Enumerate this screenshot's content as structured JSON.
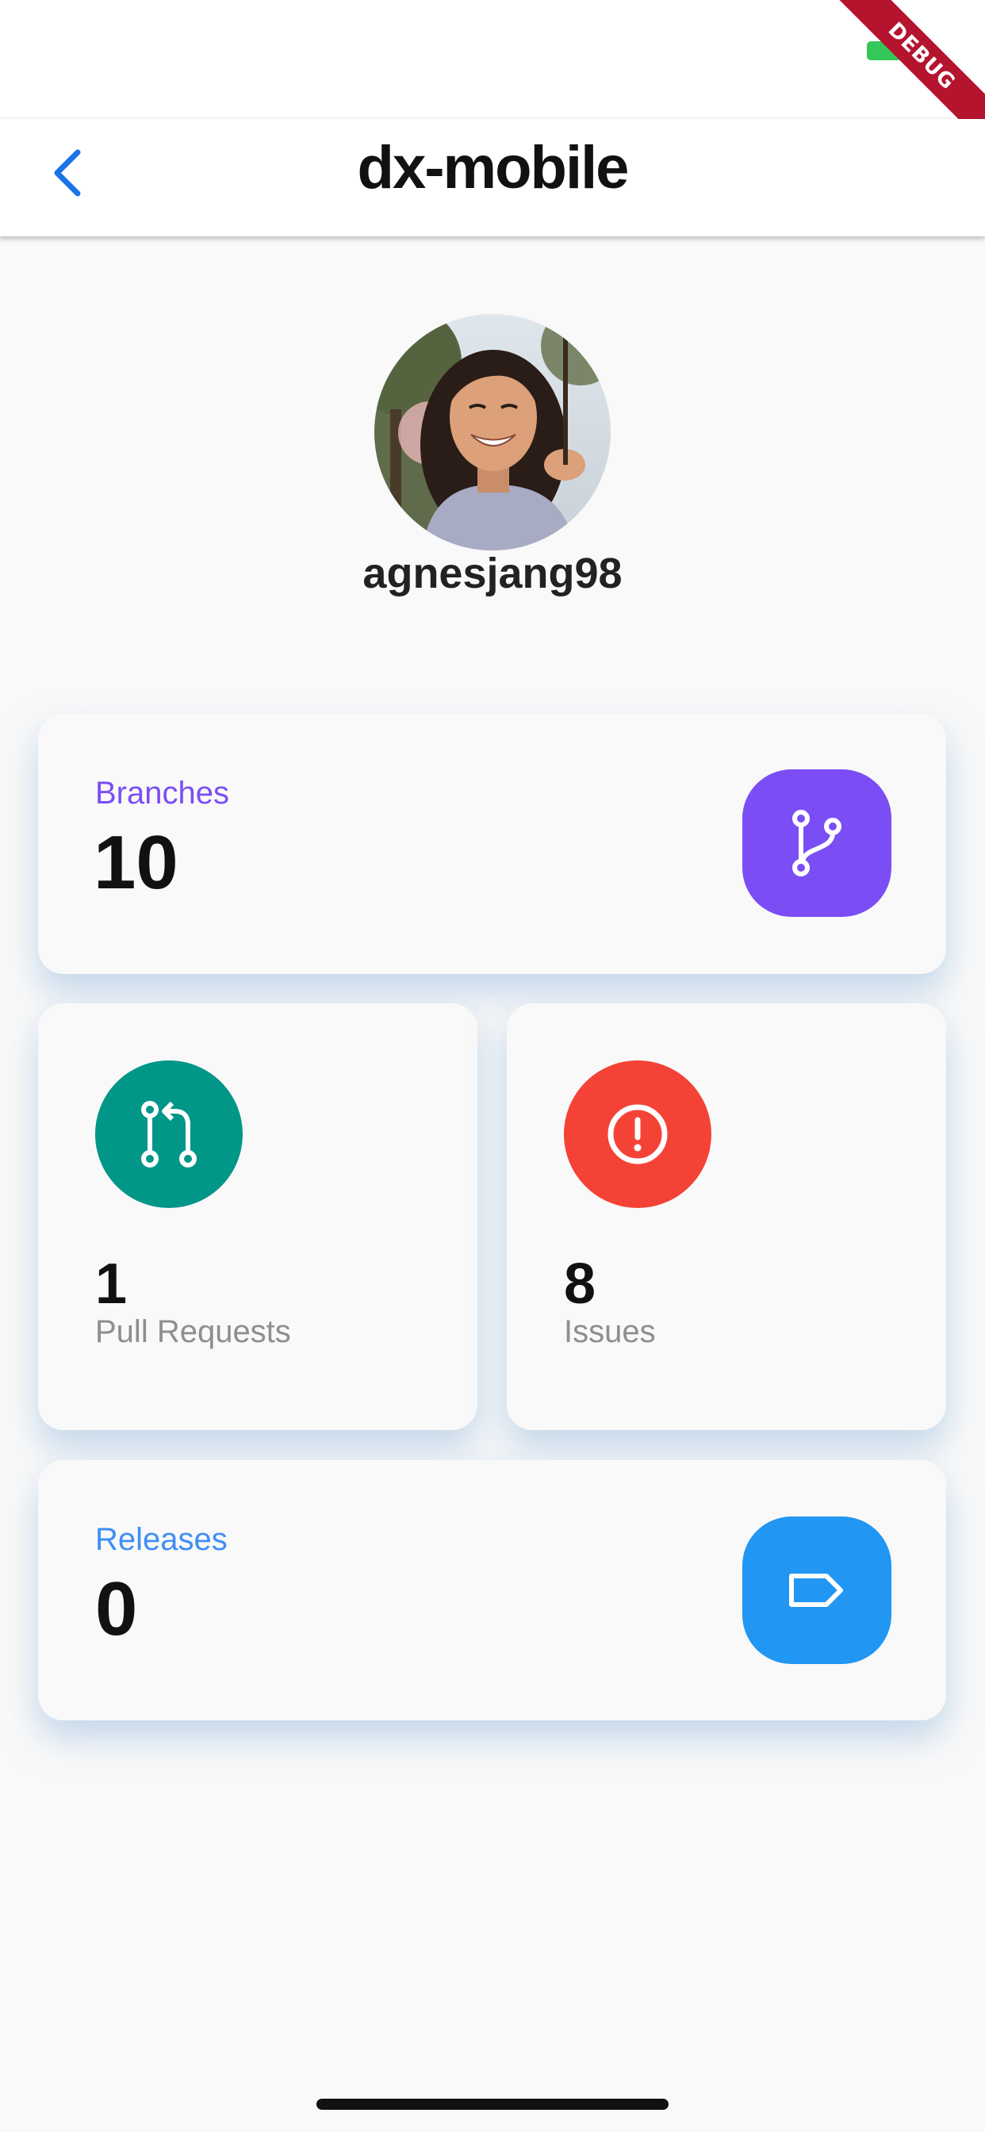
{
  "header": {
    "title": "dx-mobile",
    "debug_label": "DEBUG"
  },
  "profile": {
    "username": "agnesjang98"
  },
  "stats": {
    "branches": {
      "label": "Branches",
      "count": "10",
      "color": "#7b4df5",
      "icon": "git-branch-icon"
    },
    "pull_requests": {
      "label": "Pull Requests",
      "count": "1",
      "color": "#009688",
      "icon": "git-pull-request-icon"
    },
    "issues": {
      "label": "Issues",
      "count": "8",
      "color": "#f44336",
      "icon": "alert-circle-icon"
    },
    "releases": {
      "label": "Releases",
      "count": "0",
      "color": "#2196f3",
      "icon": "tag-icon",
      "label_color": "#3f8ef5"
    }
  },
  "colors": {
    "accent": "#1a73e8",
    "background": "#f9f9f9"
  }
}
